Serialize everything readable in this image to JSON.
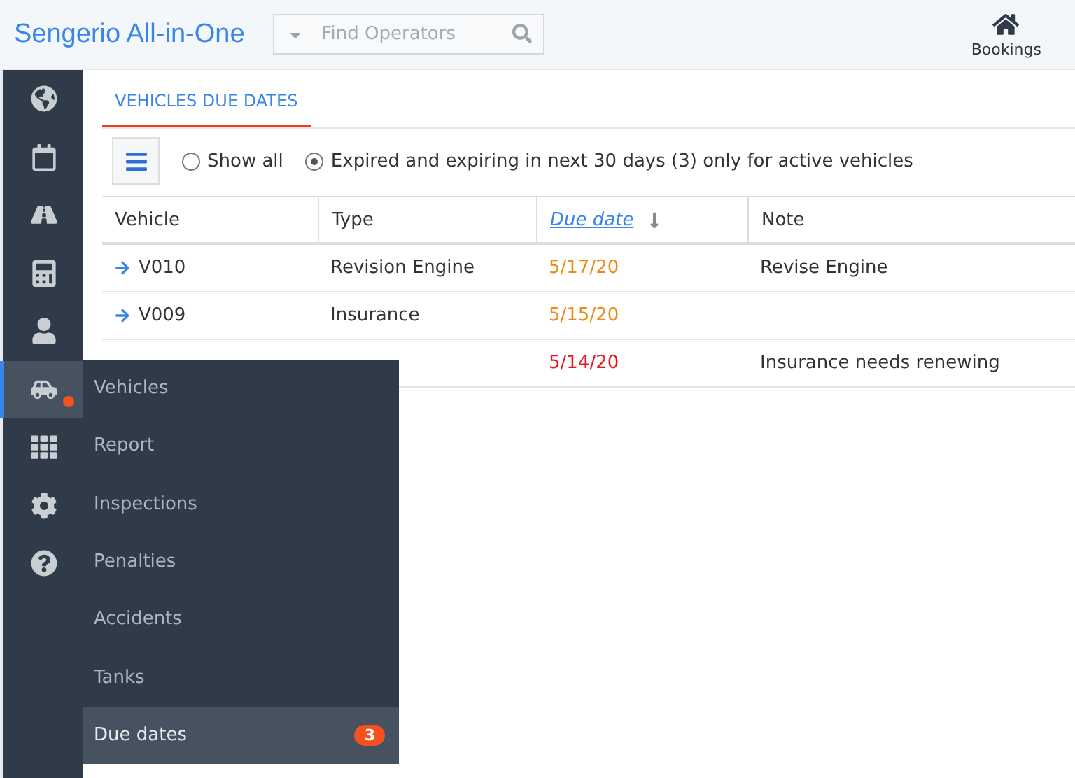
{
  "header": {
    "title": "Sengerio All-in-One",
    "search": {
      "placeholder": "Find Operators"
    },
    "bookings": {
      "label": "Bookings"
    }
  },
  "sidebar": {
    "items": [
      {
        "kind": "globe",
        "selected": false,
        "alert": false
      },
      {
        "kind": "calendar",
        "selected": false,
        "alert": false
      },
      {
        "kind": "road",
        "selected": false,
        "alert": false
      },
      {
        "kind": "calculator",
        "selected": false,
        "alert": false
      },
      {
        "kind": "user",
        "selected": false,
        "alert": false
      },
      {
        "kind": "vehicles",
        "selected": true,
        "alert": true
      },
      {
        "kind": "grid",
        "selected": false,
        "alert": false
      },
      {
        "kind": "gear",
        "selected": false,
        "alert": false
      },
      {
        "kind": "help",
        "selected": false,
        "alert": false
      }
    ]
  },
  "flyout": {
    "items": [
      {
        "label": "Vehicles",
        "selected": false
      },
      {
        "label": "Report",
        "selected": false
      },
      {
        "label": "Inspections",
        "selected": false
      },
      {
        "label": "Penalties",
        "selected": false
      },
      {
        "label": "Accidents",
        "selected": false
      },
      {
        "label": "Tanks",
        "selected": false
      },
      {
        "label": "Due dates",
        "selected": true,
        "badge": "3"
      }
    ]
  },
  "tabs": [
    {
      "label": "VEHICLES DUE DATES",
      "selected": true
    }
  ],
  "filters": [
    {
      "label": "Show all",
      "selected": false
    },
    {
      "label": "Expired and expiring in next 30 days (3) only for active vehicles",
      "selected": true
    }
  ],
  "table": {
    "columns": [
      {
        "label": "Vehicle",
        "sorted": false
      },
      {
        "label": "Type",
        "sorted": false
      },
      {
        "label": "Due date",
        "sorted": true
      },
      {
        "label": "Note",
        "sorted": false
      }
    ],
    "rows": [
      {
        "vehicle": "V010",
        "type": "Revision Engine",
        "due_date": "5/17/20",
        "color": "#f08a16",
        "note": "Revise Engine"
      },
      {
        "vehicle": "V009",
        "type": "Insurance",
        "due_date": "5/15/20",
        "color": "#f08a16"
      },
      {
        "due_date": "5/14/20",
        "color": "#e8161b",
        "note": "Insurance needs renewing"
      }
    ]
  }
}
